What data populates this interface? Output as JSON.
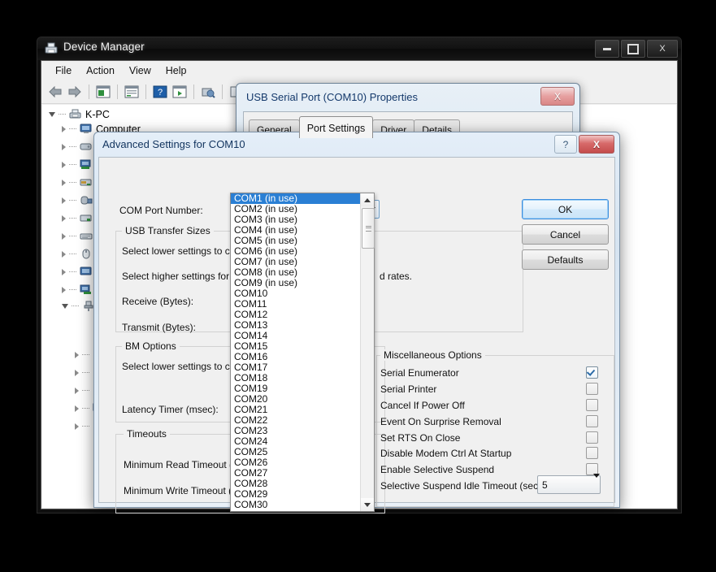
{
  "device_manager": {
    "title": "Device Manager",
    "icon": "device-manager-icon",
    "menu": [
      "File",
      "Action",
      "View",
      "Help"
    ],
    "toolbar_icons": [
      "back-arrow-icon",
      "forward-arrow-icon",
      "show-hide-console-tree-icon",
      "properties-icon",
      "help-icon",
      "scan-hardware-icon",
      "update-driver-icon",
      "enable-device-icon",
      "disable-device-icon"
    ],
    "window_buttons": {
      "minimize": "minimize-button",
      "maximize": "maximize-button",
      "close": "close-button",
      "close_glyph": "X"
    },
    "tree": {
      "root": "K-PC",
      "child": "Computer"
    }
  },
  "properties_dialog": {
    "title": "USB Serial Port (COM10) Properties",
    "close_glyph": "X",
    "tabs": [
      "General",
      "Port Settings",
      "Driver",
      "Details"
    ],
    "active_tab": "Port Settings"
  },
  "advanced_dialog": {
    "title": "Advanced Settings for COM10",
    "help_glyph": "?",
    "close_glyph": "X",
    "com_port_label": "COM Port Number:",
    "com_port_value": "COM10",
    "groups": {
      "usb_transfer": {
        "title": "USB Transfer Sizes",
        "line1": "Select lower settings to corre",
        "line2": "Select higher settings for fas",
        "line2_tail": "d rates.",
        "receive_label": "Receive (Bytes):",
        "transmit_label": "Transmit (Bytes):"
      },
      "bm_options": {
        "title": "BM Options",
        "line1": "Select lower settings to corre",
        "latency_label": "Latency Timer (msec):"
      },
      "timeouts": {
        "title": "Timeouts",
        "min_read_label": "Minimum Read Timeout (msec",
        "min_write_label": "Minimum Write Timeout (msec"
      },
      "misc": {
        "title": "Miscellaneous Options",
        "items": [
          {
            "label": "Serial Enumerator",
            "checked": true
          },
          {
            "label": "Serial Printer",
            "checked": false
          },
          {
            "label": "Cancel If Power Off",
            "checked": false
          },
          {
            "label": "Event On Surprise Removal",
            "checked": false
          },
          {
            "label": "Set RTS On Close",
            "checked": false
          },
          {
            "label": "Disable Modem Ctrl At Startup",
            "checked": false
          },
          {
            "label": "Enable Selective Suspend",
            "checked": false
          }
        ],
        "idle_timeout_label": "Selective Suspend Idle Timeout (secs):",
        "idle_timeout_value": "5"
      }
    },
    "buttons": {
      "ok": "OK",
      "cancel": "Cancel",
      "defaults": "Defaults"
    }
  },
  "com_dropdown": {
    "selected_index": 0,
    "options": [
      "COM1 (in use)",
      "COM2 (in use)",
      "COM3 (in use)",
      "COM4 (in use)",
      "COM5 (in use)",
      "COM6 (in use)",
      "COM7 (in use)",
      "COM8 (in use)",
      "COM9 (in use)",
      "COM10",
      "COM11",
      "COM12",
      "COM13",
      "COM14",
      "COM15",
      "COM16",
      "COM17",
      "COM18",
      "COM19",
      "COM20",
      "COM21",
      "COM22",
      "COM23",
      "COM24",
      "COM25",
      "COM26",
      "COM27",
      "COM28",
      "COM29",
      "COM30"
    ]
  },
  "colors": {
    "selection_blue": "#2a7fd4",
    "focus_blue": "#3c8dde",
    "close_red": "#c44c4c"
  }
}
